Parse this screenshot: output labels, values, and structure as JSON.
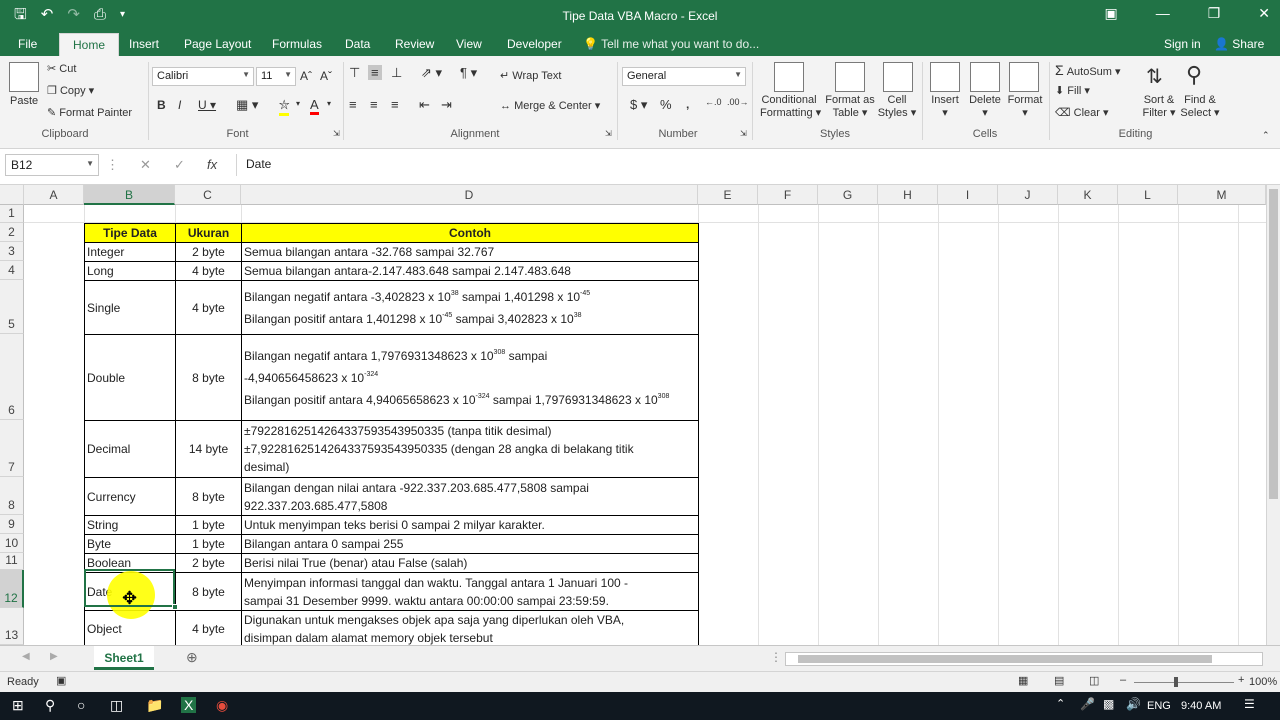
{
  "window": {
    "title": "Tipe Data VBA Macro - Excel"
  },
  "qat": {
    "save_icon": "save-icon",
    "undo_icon": "undo-icon",
    "redo_icon": "redo-icon",
    "preview_icon": "print-preview-icon"
  },
  "tabs": [
    "File",
    "Home",
    "Insert",
    "Page Layout",
    "Formulas",
    "Data",
    "Review",
    "View",
    "Developer"
  ],
  "tellme": "Tell me what you want to do...",
  "signin": "Sign in",
  "share": "Share",
  "ribbon": {
    "clipboard": {
      "label": "Clipboard",
      "paste": "Paste",
      "cut": "Cut",
      "copy": "Copy",
      "format_painter": "Format Painter"
    },
    "font": {
      "label": "Font",
      "name": "Calibri",
      "size": "11"
    },
    "alignment": {
      "label": "Alignment",
      "wrap": "Wrap Text",
      "merge": "Merge & Center"
    },
    "number": {
      "label": "Number",
      "format": "General"
    },
    "styles": {
      "label": "Styles",
      "cond1": "Conditional",
      "cond2": "Formatting",
      "fmt1": "Format as",
      "fmt2": "Table",
      "cell1": "Cell",
      "cell2": "Styles"
    },
    "cells": {
      "label": "Cells",
      "insert": "Insert",
      "delete": "Delete",
      "format": "Format"
    },
    "editing": {
      "label": "Editing",
      "autosum": "AutoSum",
      "fill": "Fill",
      "clear": "Clear",
      "sort1": "Sort &",
      "sort2": "Filter",
      "find1": "Find &",
      "find2": "Select"
    }
  },
  "formula": {
    "namebox": "B12",
    "value": "Date"
  },
  "columns": [
    "A",
    "B",
    "C",
    "D",
    "E",
    "F",
    "G",
    "H",
    "I",
    "J",
    "K",
    "L",
    "M"
  ],
  "rows": [
    "1",
    "2",
    "3",
    "4",
    "5",
    "6",
    "7",
    "8",
    "9",
    "10",
    "11",
    "12",
    "13"
  ],
  "table": {
    "headers": [
      "Tipe Data",
      "Ukuran",
      "Contoh"
    ],
    "r3": [
      "Integer",
      "2 byte",
      "Semua bilangan antara -32.768 sampai 32.767"
    ],
    "r4": [
      "Long",
      "4 byte",
      "Semua bilangan antara-2.147.483.648 sampai 2.147.483.648"
    ],
    "r5": {
      "type": "Single",
      "size": "4 byte",
      "l1a": "Bilangan negatif antara -3,402823 x 10",
      "l1b": "38",
      "l1c": " sampai 1,401298 x 10",
      "l1d": "-45",
      "l2a": "Bilangan positif antara 1,401298 x 10",
      "l2b": "-45",
      "l2c": " sampai 3,402823 x 10",
      "l2d": "38"
    },
    "r6": {
      "type": "Double",
      "size": "8 byte",
      "l1a": "Bilangan negatif antara 1,7976931348623 x 10",
      "l1b": "308",
      "l1c": " sampai",
      "l2a": "-4,940656458623 x 10",
      "l2b": "-324",
      "l3a": "Bilangan positif antara 4,94065658623 x 10",
      "l3b": "-324",
      "l3c": " sampai 1,7976931348623 x 10",
      "l3d": "308"
    },
    "r7": {
      "type": "Decimal",
      "size": "14 byte",
      "l1": "±79228162514264337593543950335 (tanpa titik desimal)",
      "l2": "±7,9228162514264337593543950335 (dengan 28 angka di belakang titik",
      "l3": "desimal)"
    },
    "r8": {
      "type": "Currency",
      "size": "8 byte",
      "l1": "Bilangan dengan nilai antara -922.337.203.685.477,5808 sampai",
      "l2": "922.337.203.685.477,5808"
    },
    "r9": [
      "String",
      "1 byte",
      "Untuk menyimpan teks berisi 0 sampai 2 milyar karakter."
    ],
    "r10": [
      "Byte",
      "1 byte",
      "Bilangan antara 0 sampai 255"
    ],
    "r11": [
      "Boolean",
      "2 byte",
      "Berisi nilai True (benar) atau False (salah)"
    ],
    "r12": {
      "type": "Date",
      "size": "8 byte",
      "l1": "Menyimpan informasi tanggal dan waktu. Tanggal antara 1 Januari 100 -",
      "l2": "sampai 31 Desember 9999. waktu antara 00:00:00 sampai 23:59:59."
    },
    "r13": {
      "type": "Object",
      "size": "4 byte",
      "l1": "Digunakan untuk mengakses objek apa saja yang diperlukan oleh VBA,",
      "l2": "disimpan dalam alamat memory objek tersebut"
    }
  },
  "sheet": {
    "name": "Sheet1"
  },
  "status": {
    "ready": "Ready",
    "zoom": "100%"
  },
  "taskbar": {
    "lang": "ENG",
    "time": "9:40 AM"
  }
}
